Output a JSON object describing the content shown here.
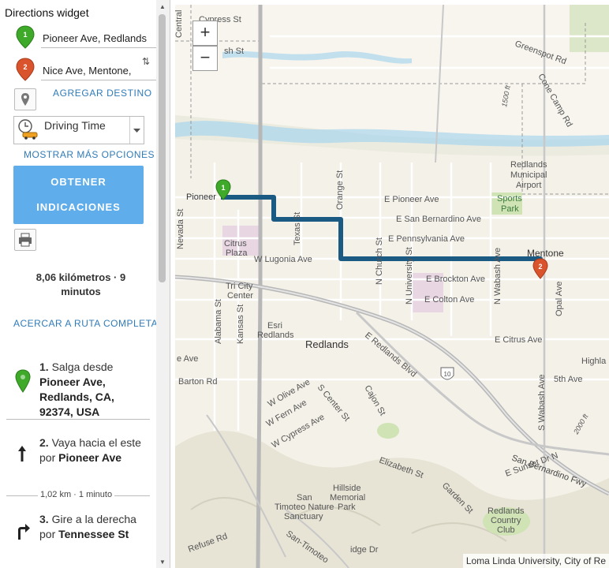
{
  "widget": {
    "title": "Directions widget",
    "origin_value": "Pioneer Ave, Redlands",
    "destination_value": "Nice Ave, Mentone,",
    "origin_marker": "1",
    "destination_marker": "2",
    "add_destination": "AGREGAR DESTINO",
    "travel_mode": "Driving Time",
    "more_options": "MOSTRAR MÁS OPCIONES",
    "get_directions": "OBTENER INDICACIONES",
    "summary": "8,06 kilómetros · 9 minutos",
    "zoom_route": "ACERCAR A RUTA COMPLETA",
    "steps": [
      {
        "num": "1.",
        "text": "Salga desde",
        "bold": "Pioneer Ave, Redlands, CA, 92374, USA"
      },
      {
        "num": "2.",
        "text": "Vaya hacia el este por",
        "bold": "Pioneer Ave",
        "distance": "1,02 km · 1 minuto"
      },
      {
        "num": "3.",
        "text": "Gire a la derecha por",
        "bold": "Tennessee St"
      }
    ]
  },
  "map": {
    "zoom_in": "+",
    "zoom_out": "−",
    "attribution": "Loma Linda University, City of Re",
    "route_color": "#1b5a82",
    "labels": {
      "cypress": "Cypress St",
      "central": "Central",
      "greenspot": "Greenspot Rd",
      "conecamp": "Cone Camp Rd",
      "st1500": "1500 ft",
      "ash": "sh St",
      "airport1": "Redlands",
      "airport2": "Municipal",
      "airport3": "Airport",
      "epioneer": "E Pioneer Ave",
      "esanbern": "E San Bernardino Ave",
      "epenn": "E Pennsylvania Ave",
      "sports1": "Sports",
      "sports2": "Park",
      "pioneer": "Pioneer",
      "orange": "Orange St",
      "texas": "Texas St",
      "nevada": "Nevada St",
      "citrus1": "Citrus",
      "citrus2": "Plaza",
      "wlugonia": "W Lugonia Ave",
      "mentone": "Mentone",
      "nchurch": "N Church St",
      "nuniv": "N University St",
      "ebrockton": "E Brockton Ave",
      "ecolton": "E Colton Ave",
      "nwabash": "N Wabash Ave",
      "opal": "Opal Ave",
      "tricity1": "Tri City",
      "tricity2": "Center",
      "esri1": "Esri",
      "esri2": "Redlands",
      "redlands": "Redlands",
      "eredlands": "E Redlands Blvd",
      "ecitrus": "E Citrus Ave",
      "alabama": "Alabama St",
      "kansas": "Kansas St",
      "eave": "e Ave",
      "barton": "Barton Rd",
      "hwy10": "10",
      "wolive": "W Olive Ave",
      "wfern": "W Fern Ave",
      "scenter": "S Center St",
      "cajon": "Cajon St",
      "wcypress": "W Cypress Ave",
      "fifth": "5th Ave",
      "highland": "Highla",
      "swabash": "S Wabash Ave",
      "ft2000": "2000 ft",
      "elizabeth": "Elizabeth St",
      "sanbernfwy": "San Bernardino Fwy",
      "esunset": "E Sunset Dr N",
      "garden": "Garden St",
      "hillside1": "Hillside",
      "hillside2": "Memorial",
      "hillside3": "Park",
      "timoteo1": "San",
      "timoteo2": "Timoteo Nature",
      "timoteo3": "Sanctuary",
      "country1": "Redlands",
      "country2": "Country",
      "country3": "Club",
      "sanltimoteo": "San-Timoteo",
      "refuse": "Refuse Rd",
      "idge": "idge Dr"
    }
  }
}
